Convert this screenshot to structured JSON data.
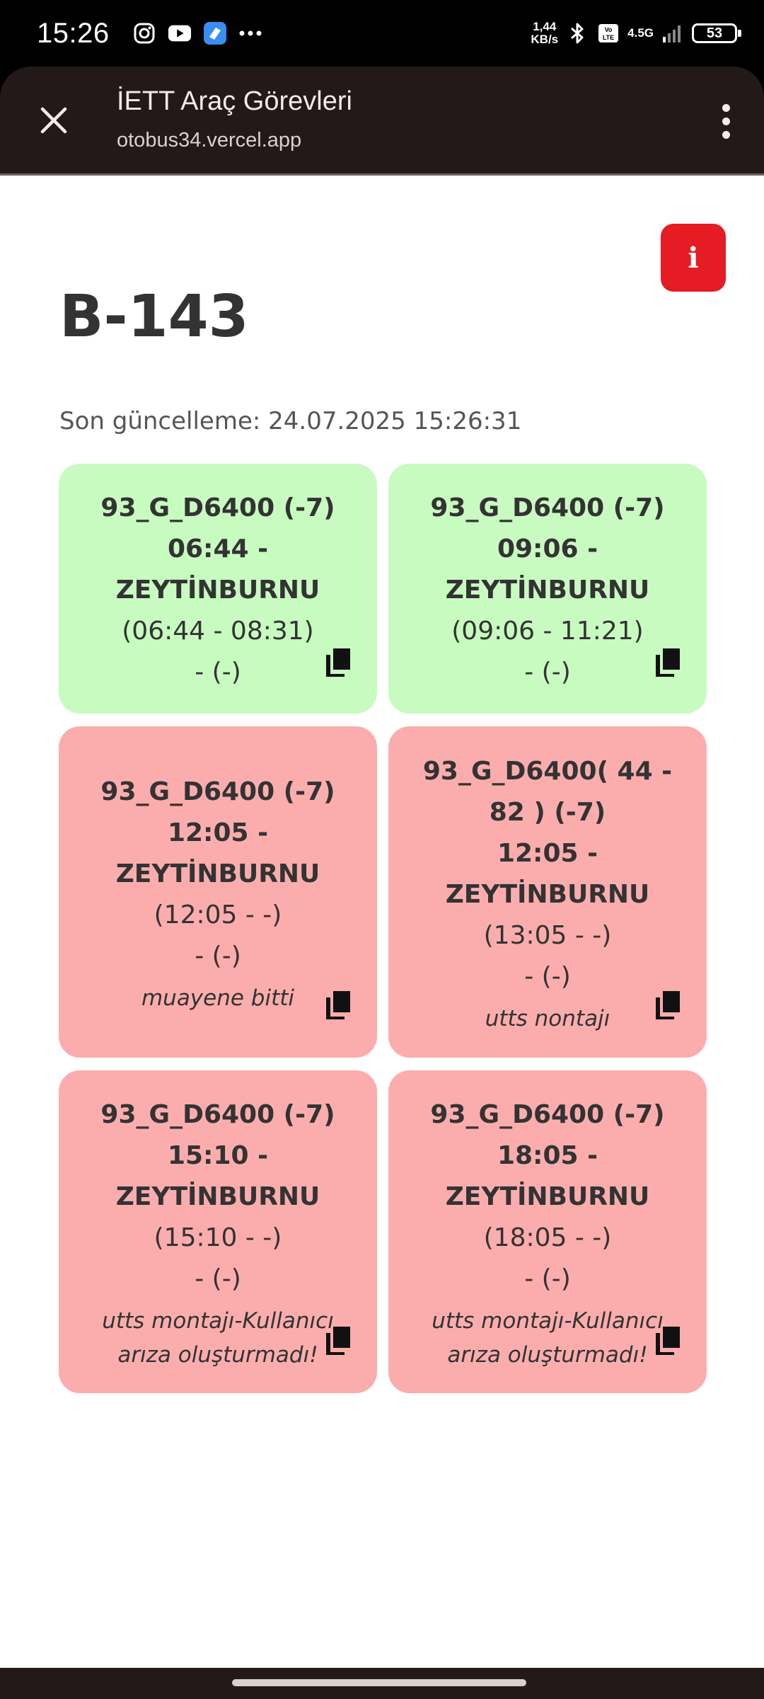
{
  "status_bar": {
    "time": "15:26",
    "app_icons": [
      "instagram-icon",
      "youtube-icon",
      "app-icon",
      "more-icon"
    ],
    "speed_value": "1,44",
    "speed_unit": "KB/s",
    "network": "4.5G",
    "battery": "53"
  },
  "toolbar": {
    "title": "İETT Araç Görevleri",
    "url": "otobus34.vercel.app"
  },
  "page": {
    "info_label": "i",
    "title": "B-143",
    "last_update": "Son güncelleme: 24.07.2025 15:26:31"
  },
  "cards": [
    {
      "status": "green",
      "line1": "93_G_D6400 (-7)",
      "line2": "06:44 -",
      "line3": "ZEYTİNBURNU",
      "range": "(06:44 - 08:31)",
      "extra": "- (-)",
      "note": ""
    },
    {
      "status": "green",
      "line1": "93_G_D6400 (-7)",
      "line2": "09:06 -",
      "line3": "ZEYTİNBURNU",
      "range": "(09:06 - 11:21)",
      "extra": "- (-)",
      "note": ""
    },
    {
      "status": "red",
      "line1": "93_G_D6400 (-7)",
      "line2": "12:05 -",
      "line3": "ZEYTİNBURNU",
      "range": "(12:05 - -)",
      "extra": "- (-)",
      "note": "muayene bitti"
    },
    {
      "status": "red",
      "line1": "93_G_D6400( 44 - 82 ) (-7)",
      "line2": "12:05 -",
      "line3": "ZEYTİNBURNU",
      "range": "(13:05 - -)",
      "extra": "- (-)",
      "note": "utts nontajı"
    },
    {
      "status": "red",
      "line1": "93_G_D6400 (-7)",
      "line2": "15:10 -",
      "line3": "ZEYTİNBURNU",
      "range": "(15:10 - -)",
      "extra": "- (-)",
      "note": "utts montajı-Kullanıcı arıza oluşturmadı!"
    },
    {
      "status": "red",
      "line1": "93_G_D6400 (-7)",
      "line2": "18:05 -",
      "line3": "ZEYTİNBURNU",
      "range": "(18:05 - -)",
      "extra": "- (-)",
      "note": "utts montajı-Kullanıcı arıza oluşturmadı!"
    }
  ],
  "colors": {
    "green_card": "#c8fbc0",
    "red_card": "#fbadad",
    "info_button": "#e51c23",
    "toolbar_bg": "#231919"
  }
}
